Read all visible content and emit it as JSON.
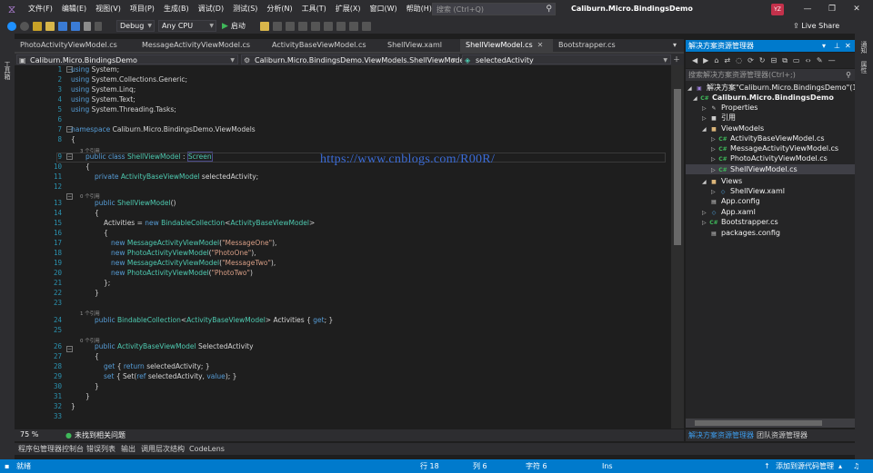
{
  "menubar": {
    "items": [
      "文件(F)",
      "编辑(E)",
      "视图(V)",
      "项目(P)",
      "生成(B)",
      "调试(D)",
      "测试(S)",
      "分析(N)",
      "工具(T)",
      "扩展(X)",
      "窗口(W)",
      "帮助(H)"
    ],
    "search_placeholder": "搜索 (Ctrl+Q)",
    "app_title": "Caliburn.Micro.BindingsDemo",
    "avatar_initials": "YZ",
    "live_share": "Live Share"
  },
  "toolbar": {
    "configuration": "Debug",
    "platform": "Any CPU",
    "start_label": "启动"
  },
  "left_strip": {
    "label": "工具箱"
  },
  "right_strip": {
    "labels": [
      "通知",
      "属性"
    ]
  },
  "tabs": [
    {
      "label": "PhotoActivityViewModel.cs",
      "active": false
    },
    {
      "label": "MessageActivityViewModel.cs",
      "active": false
    },
    {
      "label": "ActivityBaseViewModel.cs",
      "active": false
    },
    {
      "label": "ShellView.xaml",
      "active": false
    },
    {
      "label": "ShellViewModel.cs",
      "active": true
    },
    {
      "label": "Bootstrapper.cs",
      "active": false
    }
  ],
  "navbar": {
    "project": "Caliburn.Micro.BindingsDemo",
    "type": "Caliburn.Micro.BindingsDemo.ViewModels.ShellViewModel",
    "member": "selectedActivity"
  },
  "editor": {
    "watermark": "https://www.cnblogs.com/R00R/",
    "codelens": {
      "refs3": "3 个引用",
      "refs0a": "0 个引用",
      "refs1": "1 个引用",
      "refs0b": "0 个引用"
    },
    "line_numbers": [
      "1",
      "2",
      "3",
      "4",
      "5",
      "6",
      "7",
      "8",
      "9",
      "10",
      "11",
      "12",
      "13",
      "14",
      "15",
      "16",
      "17",
      "18",
      "19",
      "20",
      "21",
      "22",
      "23",
      "24",
      "25",
      "26",
      "27",
      "28",
      "29",
      "30",
      "31",
      "32",
      "33"
    ],
    "lines": {
      "l1_kw": "using",
      "l1_rest": " System;",
      "l2_kw": "using",
      "l2_rest": " System.Collections.Generic;",
      "l3_kw": "using",
      "l3_rest": " System.Linq;",
      "l4_kw": "using",
      "l4_rest": " System.Text;",
      "l5_kw": "using",
      "l5_rest": " System.Threading.Tasks;",
      "l7_kw": "namespace",
      "l7_rest": " Caliburn.Micro.BindingsDemo.ViewModels",
      "l8": "{",
      "l9_kw": "public class",
      "l9_type": " ShellViewModel",
      "l9_colon": " : ",
      "l9_base": "Screen",
      "l10": "{",
      "l11_kw": "private",
      "l11_type": " ActivityBaseViewModel",
      "l11_rest": " selectedActivity;",
      "l13_kw": "public",
      "l13_type": " ShellViewModel",
      "l13_rest": "()",
      "l14": "{",
      "l15_a": "Activities = ",
      "l15_kw": "new",
      "l15_type": " BindableCollection",
      "l15_lt": "<",
      "l15_type2": "ActivityBaseViewModel",
      "l15_gt": ">",
      "l16": "{",
      "l17_kw": "new",
      "l17_type": " MessageActivityViewModel",
      "l17_o": "(",
      "l17_s": "\"MessageOne\"",
      "l17_c": "),",
      "l18_kw": "new",
      "l18_type": " PhotoActivityViewModel",
      "l18_o": "(",
      "l18_s": "\"PhotoOne\"",
      "l18_c": "),",
      "l19_kw": "new",
      "l19_type": " MessageActivityViewModel",
      "l19_o": "(",
      "l19_s": "\"MessageTwo\"",
      "l19_c": "),",
      "l20_kw": "new",
      "l20_type": " PhotoActivityViewModel",
      "l20_o": "(",
      "l20_s": "\"PhotoTwo\"",
      "l20_c": ")",
      "l21": "};",
      "l22": "}",
      "l24_kw": "public",
      "l24_type": " BindableCollection",
      "l24_lt": "<",
      "l24_type2": "ActivityBaseViewModel",
      "l24_rest": "> Activities { ",
      "l24_get": "get",
      "l24_end": "; }",
      "l26_kw": "public",
      "l26_type": " ActivityBaseViewModel",
      "l26_rest": " SelectedActivity",
      "l27": "{",
      "l28_get": "get",
      "l28_a": " { ",
      "l28_ret": "return",
      "l28_rest": " selectedActivity; }",
      "l29_set": "set",
      "l29_a": " { Set(",
      "l29_ref": "ref",
      "l29_b": " selectedActivity, ",
      "l29_val": "value",
      "l29_c": "); }",
      "l30": "}",
      "l31": "}",
      "l32": "}"
    }
  },
  "editor_status": {
    "zoom": "75 %",
    "issues": "未找到相关问题"
  },
  "bottom_tabs": [
    "程序包管理器控制台",
    "错误列表",
    "输出",
    "调用层次结构",
    "CodeLens"
  ],
  "statusbar": {
    "ready": "就绪",
    "line": "行 18",
    "col": "列 6",
    "char": "字符 6",
    "mode": "Ins",
    "source_control": "添加到源代码管理"
  },
  "solution_explorer": {
    "title": "解决方案资源管理器",
    "search_placeholder": "搜索解决方案资源管理器(Ctrl+;)",
    "tree": [
      {
        "label": "解决方案\"Caliburn.Micro.BindingsDemo\"(1 个项",
        "icon": "solution-icon"
      },
      {
        "label": "Caliburn.Micro.BindingsDemo",
        "icon": "csharp-project-icon"
      },
      {
        "label": "Properties",
        "icon": "wrench-icon"
      },
      {
        "label": "引用",
        "icon": "references-icon"
      },
      {
        "label": "ViewModels",
        "icon": "folder-icon"
      },
      {
        "label": "ActivityBaseViewModel.cs",
        "icon": "cs-file-icon"
      },
      {
        "label": "MessageActivityViewModel.cs",
        "icon": "cs-file-icon"
      },
      {
        "label": "PhotoActivityViewModel.cs",
        "icon": "cs-file-icon"
      },
      {
        "label": "ShellViewModel.cs",
        "icon": "cs-file-icon"
      },
      {
        "label": "Views",
        "icon": "folder-icon"
      },
      {
        "label": "ShellView.xaml",
        "icon": "xaml-file-icon"
      },
      {
        "label": "App.config",
        "icon": "config-file-icon"
      },
      {
        "label": "App.xaml",
        "icon": "xaml-file-icon"
      },
      {
        "label": "Bootstrapper.cs",
        "icon": "cs-file-icon"
      },
      {
        "label": "packages.config",
        "icon": "config-file-icon"
      }
    ],
    "bottom_tabs": [
      "解决方案资源管理器",
      "团队资源管理器"
    ]
  },
  "colors": {
    "accent": "#007acc",
    "keyword": "#569cd6",
    "type": "#4ec9b0",
    "string": "#d69d85",
    "watermark": "#3b6cd8"
  }
}
